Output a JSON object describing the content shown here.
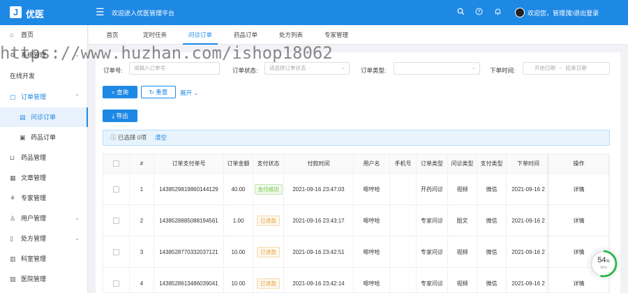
{
  "header": {
    "logo_letter": "J",
    "app_name": "优医",
    "menu_icon": "menu-fold-icon",
    "welcome": "欢迎进入优医管理平台",
    "icons": [
      "search-icon",
      "help-icon",
      "bell-icon"
    ],
    "user_text": "欢迎您，管理员",
    "logout": "退出登录",
    "color": "#1e88e5"
  },
  "sidebar": {
    "items": [
      {
        "label": "首页",
        "icon": "home-icon"
      },
      {
        "label": "系统管理",
        "icon": "settings-icon",
        "arrow": "⌄"
      },
      {
        "label": "在线开发",
        "icon": ""
      },
      {
        "label": "订单管理",
        "icon": "order-icon",
        "arrow": "⌃"
      },
      {
        "label": "问诊订单",
        "icon": "consult-order-icon",
        "sub": true,
        "active": true
      },
      {
        "label": "药品订单",
        "icon": "drug-order-icon",
        "sub": true
      },
      {
        "label": "药品管理",
        "icon": "drug-icon"
      },
      {
        "label": "文章管理",
        "icon": "article-icon"
      },
      {
        "label": "专家管理",
        "icon": "expert-icon"
      },
      {
        "label": "用户管理",
        "icon": "user-icon",
        "arrow": "⌄"
      },
      {
        "label": "处方管理",
        "icon": "prescription-icon",
        "arrow": "⌄"
      },
      {
        "label": "科室管理",
        "icon": "department-icon"
      },
      {
        "label": "医院管理",
        "icon": "hospital-icon"
      }
    ]
  },
  "tabs": [
    "首页",
    "定时任务",
    "问诊订单",
    "药品订单",
    "处方列表",
    "专家管理"
  ],
  "active_tab": 2,
  "filters": {
    "order_no_label": "订单号:",
    "order_no_placeholder": "请输入订单号",
    "status_label": "订单状态:",
    "status_placeholder": "请选择订单状态",
    "type_label": "订单类型:",
    "type_placeholder": "",
    "time_label": "下单时间:",
    "time_start": "开始日期",
    "time_sep": "~",
    "time_end": "结束日期"
  },
  "actions": {
    "search": "查询",
    "reset": "重置",
    "expand": "展开",
    "export": "导出"
  },
  "alert": {
    "text": "已选择 0项",
    "clear": "清空"
  },
  "table": {
    "columns": [
      "",
      "#",
      "订单支付单号",
      "订单金额",
      "支付状态",
      "付款时间",
      "用户名",
      "手机号",
      "订单类型",
      "问诊类型",
      "支付类型",
      "下单时间",
      "操作"
    ],
    "rows": [
      {
        "idx": "1",
        "pay_no": "1438529819860144129",
        "amount": "40.00",
        "status": "支付成功",
        "status_kind": "success",
        "pay_time": "2021-09-16 23:47:03",
        "user": "嗯哼哈",
        "phone": "",
        "order_type": "开药问诊",
        "consult_type": "视频",
        "pay_type": "微信",
        "order_time": "2021-09-16 2",
        "op": "详情"
      },
      {
        "idx": "2",
        "pay_no": "1438528885088194561",
        "amount": "1.00",
        "status": "已退款",
        "status_kind": "warn",
        "pay_time": "2021-09-16 23:43:17",
        "user": "嗯哼哈",
        "phone": "",
        "order_type": "专家问诊",
        "consult_type": "图文",
        "pay_type": "微信",
        "order_time": "2021-09-16 2",
        "op": "详情"
      },
      {
        "idx": "3",
        "pay_no": "1438528770332037121",
        "amount": "10.00",
        "status": "已退款",
        "status_kind": "warn",
        "pay_time": "2021-09-16 23:42:51",
        "user": "嗯哼哈",
        "phone": "",
        "order_type": "专家问诊",
        "consult_type": "视频",
        "pay_type": "微信",
        "order_time": "2021-09-16 2",
        "op": "详情"
      },
      {
        "idx": "4",
        "pay_no": "1438528613486039041",
        "amount": "10.00",
        "status": "已退款",
        "status_kind": "warn",
        "pay_time": "2021-09-16 23:42:14",
        "user": "嗯哼哈",
        "phone": "",
        "order_type": "专家问诊",
        "consult_type": "视频",
        "pay_type": "微信",
        "order_time": "2021-09-16 2",
        "op": "详情"
      }
    ]
  },
  "watermark": "https://www.huzhan.com/ishop18062",
  "gauge": {
    "value": "54",
    "unit": "%",
    "sub": "0K/s",
    "fraction": 0.54
  }
}
